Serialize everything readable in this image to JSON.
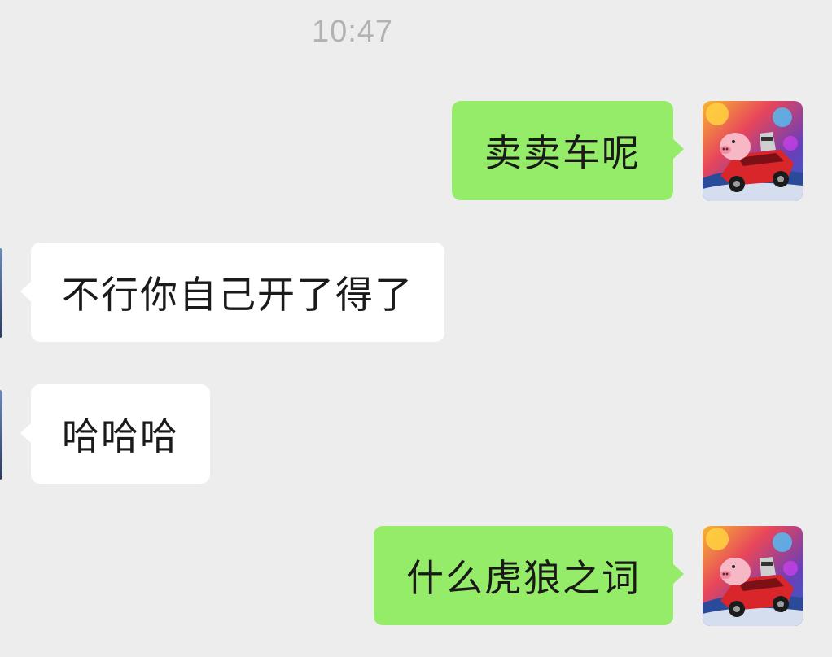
{
  "chat": {
    "timestamp": "10:47",
    "messages": [
      {
        "sender": "me",
        "text": "卖卖车呢"
      },
      {
        "sender": "peer",
        "text": "不行你自己开了得了"
      },
      {
        "sender": "peer",
        "text": "哈哈哈"
      },
      {
        "sender": "me",
        "text": "什么虎狼之词"
      }
    ]
  },
  "colors": {
    "background": "#ededed",
    "outgoing_bubble": "#95ec69",
    "incoming_bubble": "#ffffff",
    "timestamp_text": "#b2b2b2"
  },
  "icons": {
    "my_avatar": "pig-driving-red-race-car-avatar"
  }
}
